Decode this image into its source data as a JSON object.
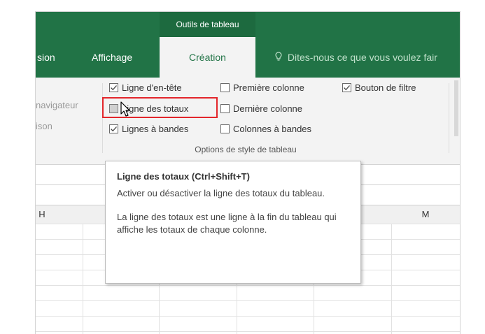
{
  "ribbon": {
    "context_tab_title": "Outils de tableau",
    "tabs": [
      {
        "label": "sion"
      },
      {
        "label": "Affichage"
      },
      {
        "label": "Création",
        "active": true
      }
    ],
    "search_placeholder": "Dites-nous ce que vous voulez fair",
    "left_items": [
      "navigateur",
      "ison"
    ],
    "options_group": {
      "label": "Options de style de tableau",
      "checkboxes": [
        {
          "label": "Ligne d'en-tête",
          "checked": true
        },
        {
          "label": "Première colonne",
          "checked": false
        },
        {
          "label": "Bouton de filtre",
          "checked": true
        },
        {
          "label": "Ligne des totaux",
          "checked": false,
          "hovered": true
        },
        {
          "label": "Dernière colonne",
          "checked": false
        },
        {
          "label": "Lignes à bandes",
          "checked": true
        },
        {
          "label": "Colonnes à bandes",
          "checked": false
        }
      ]
    }
  },
  "sheet": {
    "column_headers": [
      "H",
      "M"
    ]
  },
  "tooltip": {
    "title": "Ligne des totaux (Ctrl+Shift+T)",
    "paragraph1": "Activer ou désactiver la ligne des totaux du tableau.",
    "paragraph2": "La ligne des totaux est une ligne à la fin du tableau qui affiche les totaux de chaque colonne."
  },
  "colors": {
    "ribbon_green": "#217346",
    "highlight_red": "#e3262b"
  },
  "icons": {
    "search": "lightbulb-icon",
    "check": "checkmark-icon",
    "cursor": "mouse-pointer-icon"
  }
}
